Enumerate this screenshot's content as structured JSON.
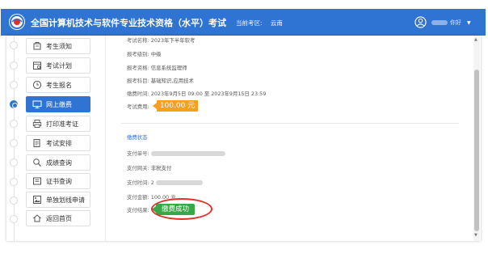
{
  "header": {
    "title": "全国计算机技术与软件专业技术资格（水平）考试",
    "region_label": "当前考区:",
    "region_value": "云南",
    "user_name": "你好"
  },
  "sidebar": {
    "items": [
      {
        "label": "考生须知",
        "icon": "notice-icon"
      },
      {
        "label": "考试计划",
        "icon": "calendar-icon"
      },
      {
        "label": "考生报名",
        "icon": "clock-icon"
      },
      {
        "label": "网上缴费",
        "icon": "monitor-icon",
        "active": true
      },
      {
        "label": "打印准考证",
        "icon": "printer-icon"
      },
      {
        "label": "考试安排",
        "icon": "document-icon"
      },
      {
        "label": "成绩查询",
        "icon": "magnifier-icon"
      },
      {
        "label": "证书查询",
        "icon": "certificate-icon"
      },
      {
        "label": "单独划线申请",
        "icon": "image-icon"
      },
      {
        "label": "返回首页",
        "icon": "home-icon"
      }
    ]
  },
  "exam_info": {
    "name_label": "考试名称:",
    "name_value": "2023年下半年软考",
    "level_label": "报考级别:",
    "level_value": "中级",
    "qual_label": "报考资格:",
    "qual_value": "信息系统监理师",
    "subject_label": "报考科目:",
    "subject_value": "基础知识,应用技术",
    "paytime_label": "缴费时间:",
    "paytime_value": "2023年9月5日 09:00 至 2023年9月15日 23:59",
    "fee_label": "考试费用:",
    "fee_value": "100.00 元"
  },
  "payment_status": {
    "section_title": "缴费状态",
    "order_label": "支付单号:",
    "order_value": "",
    "gateway_label": "支付网关:",
    "gateway_value": "非税支付",
    "time_label": "支付时间:",
    "time_value": "2",
    "amount_label": "支付金额:",
    "amount_value": "100.00 元",
    "result_label": "支付结果:",
    "result_value": "缴费成功"
  },
  "colors": {
    "brand": "#2f74d3",
    "fee_tag": "#f5a11e",
    "success": "#38a846",
    "annotation": "#e0322b"
  }
}
